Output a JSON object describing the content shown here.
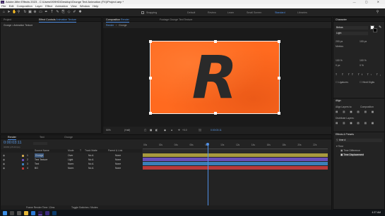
{
  "app": {
    "window_title": "Adobe After Effects 2023 - C:\\Users\\909HD\\Desktop\\Grunge Text Animation (FX)\\Project.aep *",
    "menu": [
      "File",
      "Edit",
      "Composition",
      "Layer",
      "Effect",
      "Animation",
      "View",
      "Window",
      "Help"
    ],
    "snapping_label": "Snapping",
    "workspaces": [
      "Default",
      "Review",
      "Learn",
      "Small Screen",
      "Standard",
      "Libraries"
    ],
    "active_workspace": "Standard"
  },
  "left_panel": {
    "tabs": [
      "Project",
      "Effect Controls",
      "Animation Texture"
    ],
    "effect_controls_title": "Grunge • Animation Texture"
  },
  "comp_panel": {
    "tabs": [
      "Composition",
      "Render",
      "Footage",
      "Grunge Text Texture"
    ],
    "breadcrumbs": [
      "Render",
      "Grunge"
    ],
    "art_letter": "R",
    "zoom": "50%",
    "resolution": "(Half)",
    "exposure": "+0.0",
    "timecode": "0:00:03:11",
    "art_colors": {
      "orange": "#ff6a1f",
      "letter": "#2a2a2a"
    }
  },
  "right_panel": {
    "character_tab": "Character",
    "font_name": "Bebas",
    "font_style": "Light",
    "size_value": "200 px",
    "tracking_value": "100 px",
    "metrics_label": "Metrics",
    "vscale": "100 %",
    "hscale": "100 %",
    "baseline": "0 px",
    "tsume": "0 %",
    "ligatures_label": "Ligatures",
    "hindi_digits_label": "Hindi Digits",
    "align_tab": "Align",
    "align_layers_to_label": "Align Layers to:",
    "align_layers_to_value": "Composition",
    "distribute_layers_label": "Distribute Layers:",
    "effects_presets_tab": "Effects & Presets",
    "effects_search": "time d",
    "effects_items": [
      "Time",
      "Time Difference",
      "Time Displacement"
    ]
  },
  "timeline": {
    "tabs": [
      "Render",
      "Text",
      "Grunge"
    ],
    "timecode": "0:00:03:11",
    "frame_info": "00083 (25.00 fps)",
    "columns": [
      "Source Name",
      "Mode",
      "T",
      "Track Matte",
      "Parent & Link"
    ],
    "layers": [
      {
        "num": "1",
        "name": "Grunge",
        "mode": "Over",
        "matte": "No A",
        "parent": "None",
        "color": "#c9a24d"
      },
      {
        "num": "2",
        "name": "Text Texture",
        "mode": "Light",
        "matte": "No A",
        "parent": "None",
        "color": "#6a4fb8"
      },
      {
        "num": "3",
        "name": "Text",
        "mode": "Norm",
        "matte": "No A",
        "parent": "None",
        "color": "#3a7fb8"
      },
      {
        "num": "4",
        "name": "BG",
        "mode": "Norm",
        "matte": "No A",
        "parent": "None",
        "color": "#b83a3a"
      }
    ],
    "ruler_labels": [
      "00s",
      "02s",
      "04s",
      "06s",
      "08s",
      "10s",
      "12s",
      "14s",
      "16s",
      "18s",
      "20s",
      "22s"
    ],
    "playhead_fraction": 0.35,
    "bar_colors": [
      "#a89a3e",
      "#6a4fb8",
      "#3a7fb8",
      "#b83a3a"
    ],
    "footer_left": "Frame Render Time: 13ms",
    "footer_mid": "Toggle Switches / Modes"
  },
  "taskbar": {
    "time": "4:37 AM"
  }
}
